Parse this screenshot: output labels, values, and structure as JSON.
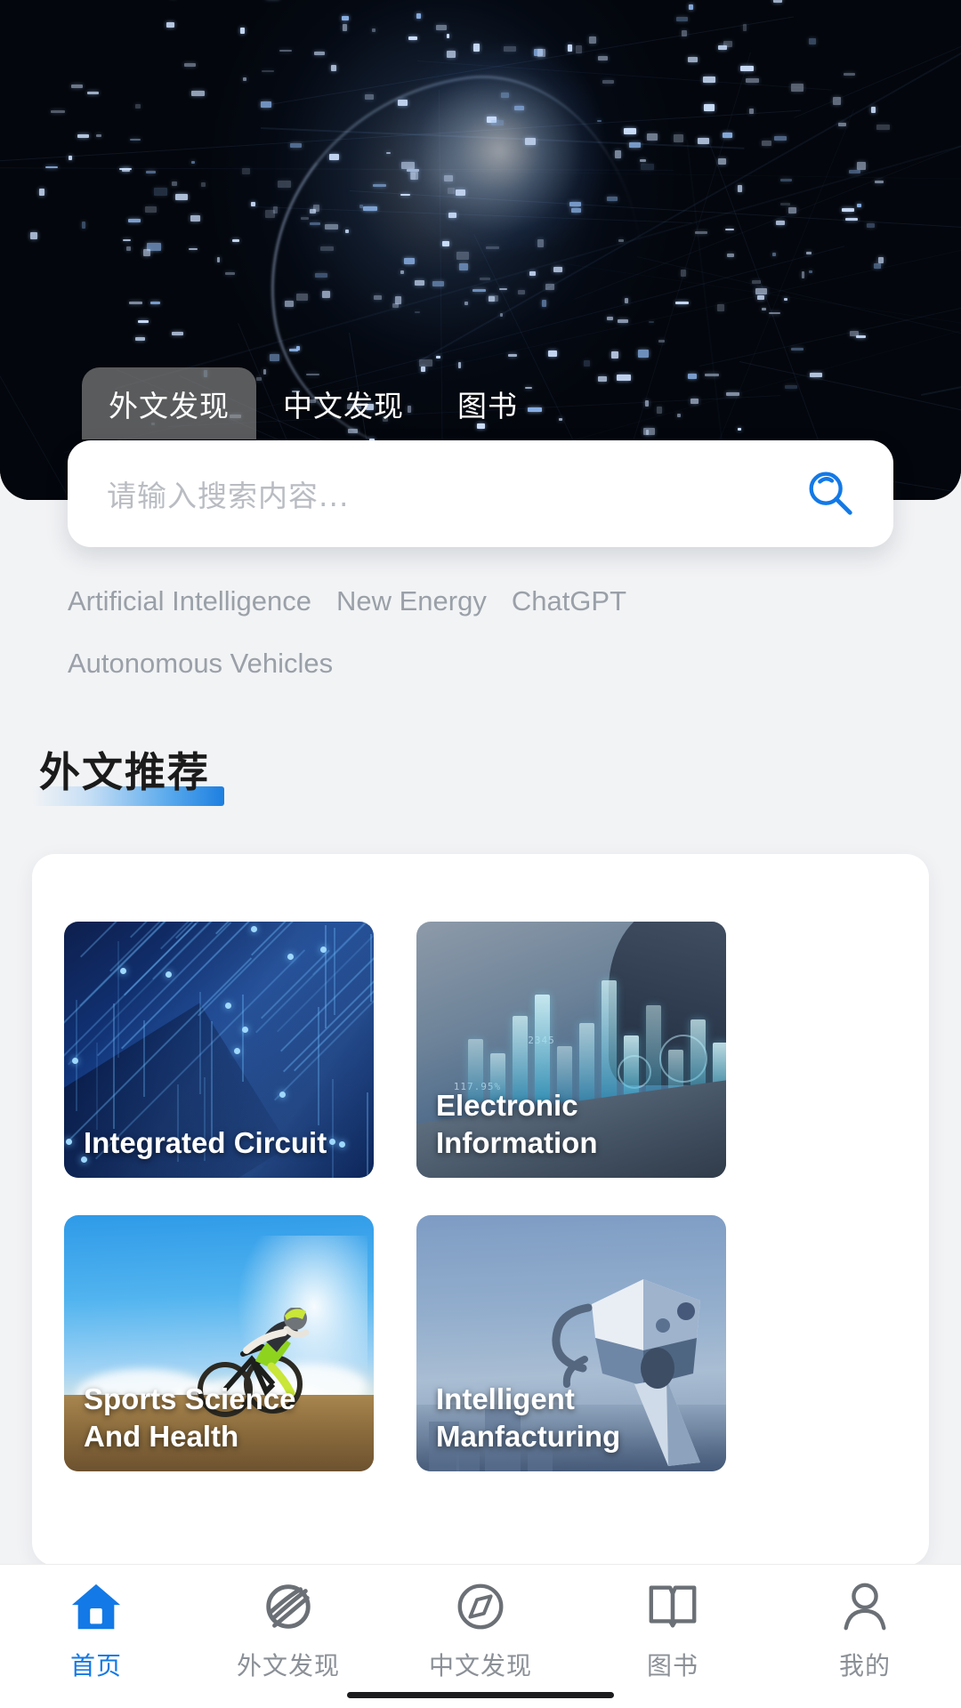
{
  "app": {
    "title": "外文发现",
    "accent_color": "#1379e6",
    "hero_background_color": "#03060c"
  },
  "tabs": {
    "items": [
      {
        "label": "外文发现",
        "active": true
      },
      {
        "label": "中文发现",
        "active": false
      },
      {
        "label": "图书",
        "active": false
      }
    ]
  },
  "search": {
    "placeholder": "请输入搜索内容...",
    "value": "",
    "icon": "search-icon",
    "icon_color": "#1379e6"
  },
  "hot_tags": {
    "items": [
      "Artificial Intelligence",
      "New Energy",
      "ChatGPT",
      "Autonomous Vehicles"
    ]
  },
  "recommend_section": {
    "title": "外文推荐",
    "underline_gradient_end": "#1d7fe0"
  },
  "cards": [
    {
      "title": "Integrated Circuit",
      "art": "circuit-board-artwork"
    },
    {
      "title": "Electronic\nInformation",
      "art": "data-hologram-artwork"
    },
    {
      "title": "Sports Science And\nHealth",
      "art": "mountain-biker-artwork"
    },
    {
      "title": "Intelligent\nManfacturing",
      "art": "robot-arm-artwork"
    }
  ],
  "bottom_nav": {
    "items": [
      {
        "label": "首页",
        "icon": "home-icon",
        "active": true
      },
      {
        "label": "外文发现",
        "icon": "planet-icon",
        "active": false
      },
      {
        "label": "中文发现",
        "icon": "compass-icon",
        "active": false
      },
      {
        "label": "图书",
        "icon": "book-icon",
        "active": false
      },
      {
        "label": "我的",
        "icon": "person-icon",
        "active": false
      }
    ]
  }
}
